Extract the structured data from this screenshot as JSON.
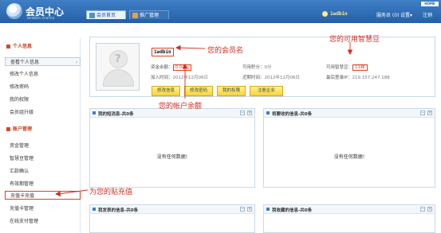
{
  "header": {
    "logo_title": "会员中心",
    "logo_subtitle": "MEMBER CENTER",
    "tabs": [
      {
        "label": "会员首页",
        "active": true
      },
      {
        "label": "推广管理",
        "active": false
      }
    ],
    "username": "1wdbin",
    "service_label": "服务员 (0)",
    "settings_label": "设置",
    "settings_arrow": "▾",
    "logout_label": "注销",
    "home_badge": "HOME"
  },
  "sidebar": {
    "sections": [
      {
        "title": "个人信息",
        "items": [
          {
            "label": "查看个人信息",
            "selected": true,
            "chevron": "›"
          },
          {
            "label": "修改个人信息"
          },
          {
            "label": "修改密码"
          },
          {
            "label": "我的权限"
          },
          {
            "label": "会员组升级"
          }
        ]
      },
      {
        "title": "账户管理",
        "items": [
          {
            "label": "资金管理"
          },
          {
            "label": "智慧豆管理"
          },
          {
            "label": "汇款确认"
          },
          {
            "label": "有效期管理"
          },
          {
            "label": "充值卡充值",
            "highlighted": true
          },
          {
            "label": "充值卡管理"
          },
          {
            "label": "在线支付管理"
          }
        ]
      }
    ]
  },
  "profile": {
    "username": "1wdbin",
    "balance_label": "资金余额：",
    "balance_value": "0.00元",
    "points_label": "可用积分：",
    "points_value": "0分",
    "beans_label": "可用智慧豆：",
    "beans_value": "11颗",
    "join_label": "加入时间：",
    "join_value": "2012年12月06日",
    "recent_label": "近期时间：",
    "recent_value": "2012年12月06日",
    "last_login_label": "最后登录IP：",
    "last_login_value": "219.157.247.188",
    "buttons": [
      "修改信息",
      "修改密码",
      "我的权限",
      "注册企业"
    ]
  },
  "panels": [
    {
      "title": "我的短消息-共0条",
      "empty": "没有任何数据!"
    },
    {
      "title": "将要收的信息-共0条",
      "empty": "没有任何数据!"
    },
    {
      "title": "我发表的信息-共0条",
      "empty": ""
    },
    {
      "title": "我收藏的信息-共0条",
      "empty": ""
    }
  ],
  "panel_controls": {
    "minimize": "−",
    "close": "×"
  },
  "annotations": {
    "member_name": "您的会员名",
    "beans": "您的可用智慧豆",
    "balance": "您的帐户余额",
    "recharge": "为您的贴充值"
  },
  "colors": {
    "header": "#2460a8",
    "accent_red": "#e04020",
    "annotation": "#d62b1f",
    "button_yellow": "#f7d23a"
  }
}
